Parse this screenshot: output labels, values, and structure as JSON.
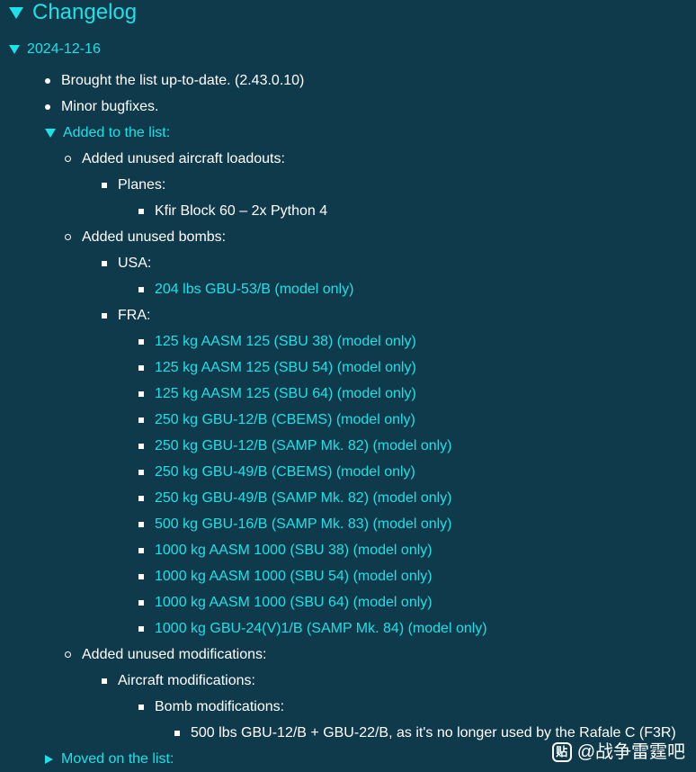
{
  "title": "Changelog",
  "date": "2024-12-16",
  "top_items": [
    "Brought the list up-to-date. (2.43.0.10)",
    "Minor bugfixes."
  ],
  "added_section": "Added to the list:",
  "loadouts": {
    "label": "Added unused aircraft loadouts:",
    "planes_label": "Planes:",
    "planes": [
      "Kfir Block 60 – 2x Python 4"
    ]
  },
  "bombs": {
    "label": "Added unused bombs:",
    "usa_label": "USA:",
    "usa": [
      "204 lbs GBU-53/B (model only)"
    ],
    "fra_label": "FRA:",
    "fra": [
      "125 kg AASM 125 (SBU 38) (model only)",
      "125 kg AASM 125 (SBU 54) (model only)",
      "125 kg AASM 125 (SBU 64) (model only)",
      "250 kg GBU-12/B (CBEMS) (model only)",
      "250 kg GBU-12/B (SAMP Mk. 82) (model only)",
      "250 kg GBU-49/B (CBEMS) (model only)",
      "250 kg GBU-49/B (SAMP Mk. 82) (model only)",
      "500 kg GBU-16/B (SAMP Mk. 83) (model only)",
      "1000 kg AASM 1000 (SBU 38) (model only)",
      "1000 kg AASM 1000 (SBU 54) (model only)",
      "1000 kg AASM 1000 (SBU 64) (model only)",
      "1000 kg GBU-24(V)1/B (SAMP Mk. 84) (model only)"
    ]
  },
  "mods": {
    "label": "Added unused modifications:",
    "aircraft_label": "Aircraft modifications:",
    "bomb_label": "Bomb modifications:",
    "bomb_items": [
      "500 lbs GBU-12/B + GBU-22/B, as it's no longer used by the Rafale C (F3R)"
    ]
  },
  "moved_section": "Moved on the list:",
  "watermark": {
    "icon_text": "贴",
    "text": "@战争雷霆吧"
  },
  "colors": {
    "background": "#0f3a4b",
    "accent": "#1fe0e6",
    "text": "#ffffff"
  },
  "icons": {
    "expanded": "triangle-down-icon",
    "collapsed": "triangle-right-icon"
  }
}
